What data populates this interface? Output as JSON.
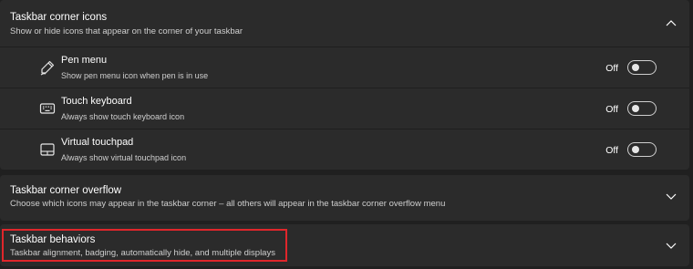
{
  "corner_icons": {
    "title": "Taskbar corner icons",
    "subtitle": "Show or hide icons that appear on the corner of your taskbar",
    "expanded": true,
    "items": [
      {
        "icon": "pen-icon",
        "title": "Pen menu",
        "description": "Show pen menu icon when pen is in use",
        "state_label": "Off",
        "on": false
      },
      {
        "icon": "keyboard-icon",
        "title": "Touch keyboard",
        "description": "Always show touch keyboard icon",
        "state_label": "Off",
        "on": false
      },
      {
        "icon": "touchpad-icon",
        "title": "Virtual touchpad",
        "description": "Always show virtual touchpad icon",
        "state_label": "Off",
        "on": false
      }
    ]
  },
  "corner_overflow": {
    "title": "Taskbar corner overflow",
    "subtitle": "Choose which icons may appear in the taskbar corner – all others will appear in the taskbar corner overflow menu",
    "expanded": false
  },
  "behaviors": {
    "title": "Taskbar behaviors",
    "subtitle": "Taskbar alignment, badging, automatically hide, and multiple displays",
    "expanded": false,
    "highlighted": true
  },
  "colors": {
    "background": "#202020",
    "card": "#2b2b2b",
    "highlight": "#e0262b"
  }
}
